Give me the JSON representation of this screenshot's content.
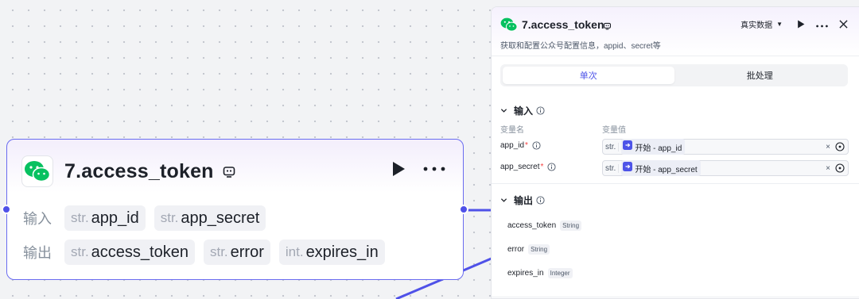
{
  "node": {
    "title": "7.access_token",
    "input_label": "输入",
    "output_label": "输出",
    "inputs": [
      {
        "type": "str.",
        "name": "app_id"
      },
      {
        "type": "str.",
        "name": "app_secret"
      }
    ],
    "outputs": [
      {
        "type": "str.",
        "name": "access_token"
      },
      {
        "type": "str.",
        "name": "error"
      },
      {
        "type": "int.",
        "name": "expires_in"
      }
    ]
  },
  "panel": {
    "title": "7.access_token",
    "description": "获取和配置公众号配置信息，appid、secret等",
    "data_mode": "真实数据",
    "tabs": [
      {
        "label": "单次",
        "active": true
      },
      {
        "label": "批处理",
        "active": false
      }
    ],
    "input_section": {
      "title": "输入",
      "col_name": "变量名",
      "col_value": "变量值",
      "vars": [
        {
          "name": "app_id",
          "required_mark": "*",
          "type": "str.",
          "source": "开始 - app_id"
        },
        {
          "name": "app_secret",
          "required_mark": "*",
          "type": "str.",
          "source": "开始 - app_secret"
        }
      ]
    },
    "output_section": {
      "title": "输出",
      "items": [
        {
          "name": "access_token",
          "type": "String"
        },
        {
          "name": "error",
          "type": "String"
        },
        {
          "name": "expires_in",
          "type": "Integer"
        }
      ]
    }
  },
  "colors": {
    "accent": "#4d53e8",
    "node_border": "#6a6cf0",
    "edge": "#4f51e8",
    "wechat_green": "#07c160"
  },
  "icons": [
    "wechat-icon",
    "bot-icon",
    "play-icon",
    "more-icon",
    "close-icon",
    "chevron-down-icon",
    "info-icon",
    "start-node-icon",
    "crosshair-icon"
  ]
}
